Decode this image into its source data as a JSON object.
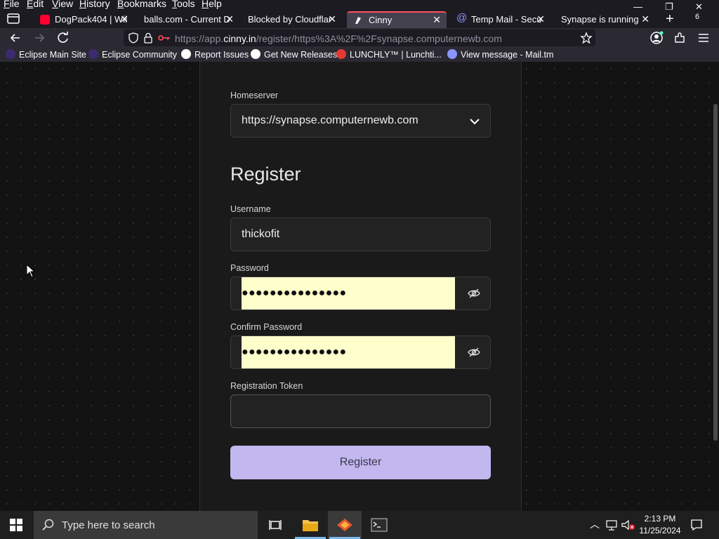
{
  "menubar": {
    "items": [
      "File",
      "Edit",
      "View",
      "History",
      "Bookmarks",
      "Tools",
      "Help"
    ]
  },
  "window": {
    "minimize": "—",
    "restore": "❐",
    "close": "✕"
  },
  "tabs": [
    {
      "title": "DogPack404 | Wil",
      "favicon": "youtube-icon",
      "color": "#ff0033",
      "active": false
    },
    {
      "title": "balls.com - Current D",
      "favicon": "none",
      "color": "",
      "active": false
    },
    {
      "title": "Blocked by Cloudflar",
      "favicon": "none",
      "color": "",
      "active": false
    },
    {
      "title": "Cinny",
      "favicon": "cinny-icon",
      "color": "#ffffff",
      "active": true
    },
    {
      "title": "Temp Mail - Secu",
      "favicon": "at-icon",
      "color": "#8b95ff",
      "active": false
    },
    {
      "title": "Synapse is running",
      "favicon": "none",
      "color": "",
      "active": false
    }
  ],
  "tab_count": "6",
  "url": {
    "prefix": "https://app.",
    "domain": "cinny.in",
    "rest": "/register/https%3A%2F%2Fsynapse.computernewb.com"
  },
  "bookmarks": [
    {
      "label": "Eclipse Main Site",
      "icon": "eclipse-icon",
      "color": "#3d2a6e"
    },
    {
      "label": "Eclipse Community",
      "icon": "eclipse-icon",
      "color": "#3d2a6e"
    },
    {
      "label": "Report Issues",
      "icon": "github-icon",
      "color": "#ffffff"
    },
    {
      "label": "Get New Releases",
      "icon": "github-icon",
      "color": "#ffffff"
    },
    {
      "label": "LUNCHLY™ | Lunchti...",
      "icon": "lunchly-icon",
      "color": "#e53935"
    },
    {
      "label": "View message - Mail.tm",
      "icon": "at-icon",
      "color": "#8b95ff"
    }
  ],
  "form": {
    "homeserver_label": "Homeserver",
    "homeserver_value": "https://synapse.computernewb.com",
    "heading": "Register",
    "username_label": "Username",
    "username_value": "thickofit",
    "password_label": "Password",
    "password_mask": "●●●●●●●●●●●●●●●",
    "confirm_label": "Confirm Password",
    "confirm_mask": "●●●●●●●●●●●●●●●",
    "token_label": "Registration Token",
    "token_value": "",
    "submit_label": "Register"
  },
  "taskbar": {
    "search_placeholder": "Type here to search",
    "time": "2:13 PM",
    "date": "11/25/2024"
  },
  "colors": {
    "accent_button": "#c2b8ef",
    "autofill": "#ffffcc",
    "active_tab_line": "#ff4f5e"
  }
}
